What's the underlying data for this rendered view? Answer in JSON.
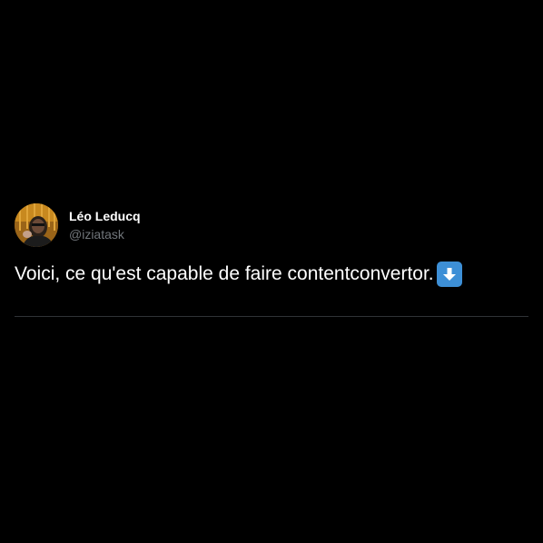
{
  "author": {
    "display_name": "Léo Leducq",
    "handle": "@iziatask"
  },
  "tweet": {
    "text": "Voici, ce qu'est capable de faire contentconvertor.",
    "emoji": "arrow-down-emoji"
  },
  "colors": {
    "background": "#000000",
    "text": "#ffffff",
    "secondary_text": "#71767b",
    "divider": "#2f3336",
    "emoji_bg": "#3d8fd6"
  }
}
